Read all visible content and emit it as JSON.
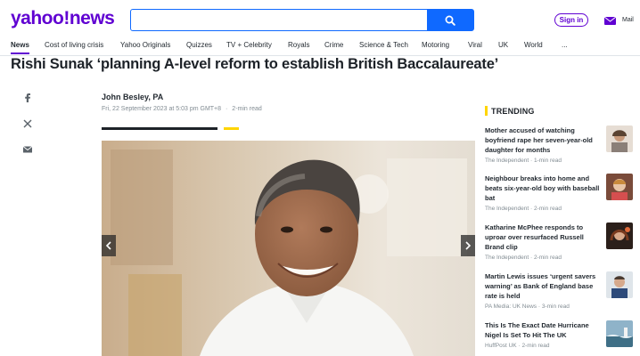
{
  "header": {
    "logo": "yahoo!news",
    "search_placeholder": "",
    "signin_label": "Sign in",
    "mail_label": "Mail"
  },
  "nav": {
    "items": [
      "News",
      "Cost of living crisis",
      "Yahoo Originals",
      "Quizzes",
      "TV + Celebrity",
      "Royals",
      "Crime",
      "Science & Tech",
      "Motoring",
      "Viral",
      "UK",
      "World",
      "..."
    ]
  },
  "article": {
    "headline": "Rishi Sunak ‘planning A-level reform to establish British Baccalaureate’",
    "author": "John Besley, PA",
    "date": "Fri, 22 September 2023 at 5:03 pm GMT+8",
    "read_time": "2-min read"
  },
  "trending": {
    "title": "TRENDING",
    "items": [
      {
        "title": "Mother accused of watching boyfriend rape her seven-year-old daughter for months",
        "source": "The Independent",
        "time": "1-min read"
      },
      {
        "title": "Neighbour breaks into home and beats six-year-old boy with baseball bat",
        "source": "The Independent",
        "time": "2-min read"
      },
      {
        "title": "Katharine McPhee responds to uproar over resurfaced Russell Brand clip",
        "source": "The Independent",
        "time": "2-min read"
      },
      {
        "title": "Martin Lewis issues ‘urgent savers warning’ as Bank of England base rate is held",
        "source": "PA Media: UK News",
        "time": "3-min read"
      },
      {
        "title": "This Is The Exact Date Hurricane Nigel Is Set To Hit The UK",
        "source": "HuffPost UK",
        "time": "2-min read"
      }
    ]
  },
  "colors": {
    "brand": "#6001d2",
    "search_blue": "#0f69ff",
    "trending_accent": "#ffd500"
  }
}
